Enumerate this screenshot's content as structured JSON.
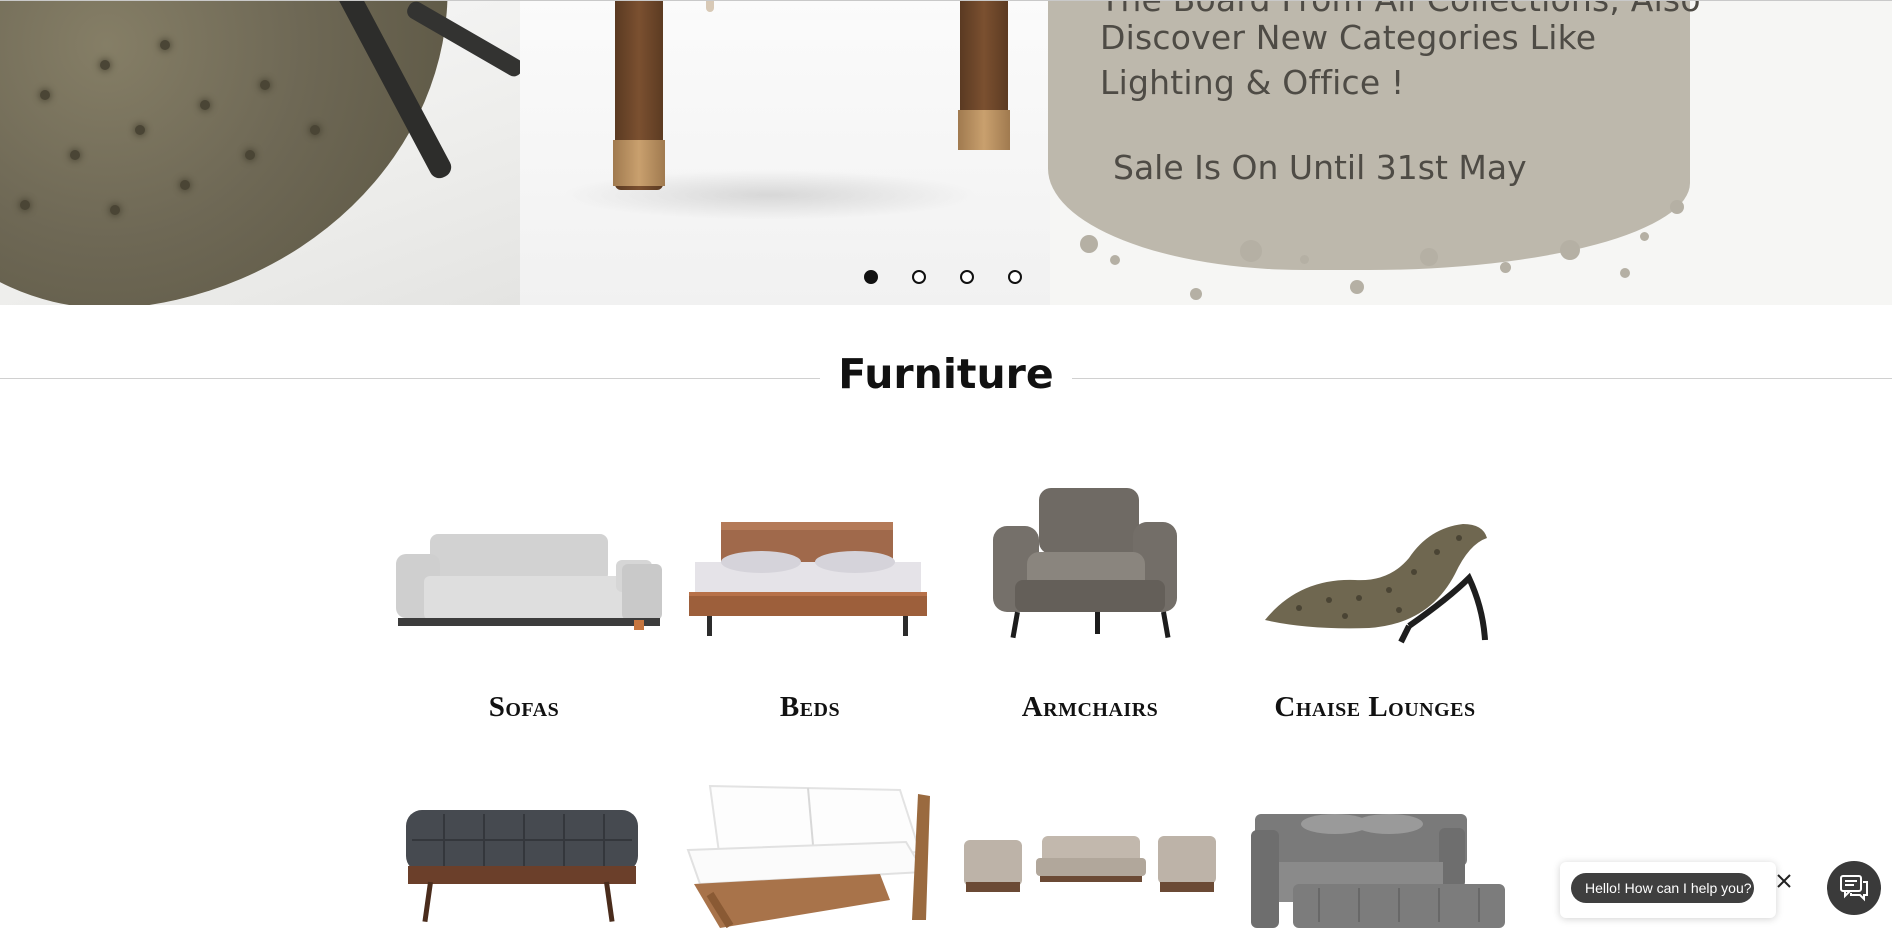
{
  "hero": {
    "text_line_1": "The Board From All Collections, Also",
    "text_line_2": "Discover New Categories Like",
    "text_line_3": "Lighting & Office !",
    "sale_text": "Sale Is On Until 31st May",
    "slides_total": 4,
    "active_slide": 1
  },
  "section": {
    "title": "Furniture"
  },
  "categories": [
    {
      "label": "Sofas",
      "icon": "sofa-image"
    },
    {
      "label": "Beds",
      "icon": "bed-image"
    },
    {
      "label": "Armchairs",
      "icon": "armchair-image"
    },
    {
      "label": "Chaise Lounges",
      "icon": "chaise-lounge-image"
    },
    {
      "label": "",
      "icon": "ottoman-image"
    },
    {
      "label": "",
      "icon": "outdoor-loveseat-image"
    },
    {
      "label": "",
      "icon": "sofa-set-image"
    },
    {
      "label": "",
      "icon": "trundle-daybed-image"
    }
  ],
  "chat": {
    "greeting": "Hello! How can I help you?",
    "close_icon": "close-icon",
    "launcher_icon": "chat-icon"
  },
  "colors": {
    "paint_blob": "#bdb8ac",
    "hero_text": "#4e4b45",
    "chat_bubble": "#3f3f3f"
  }
}
